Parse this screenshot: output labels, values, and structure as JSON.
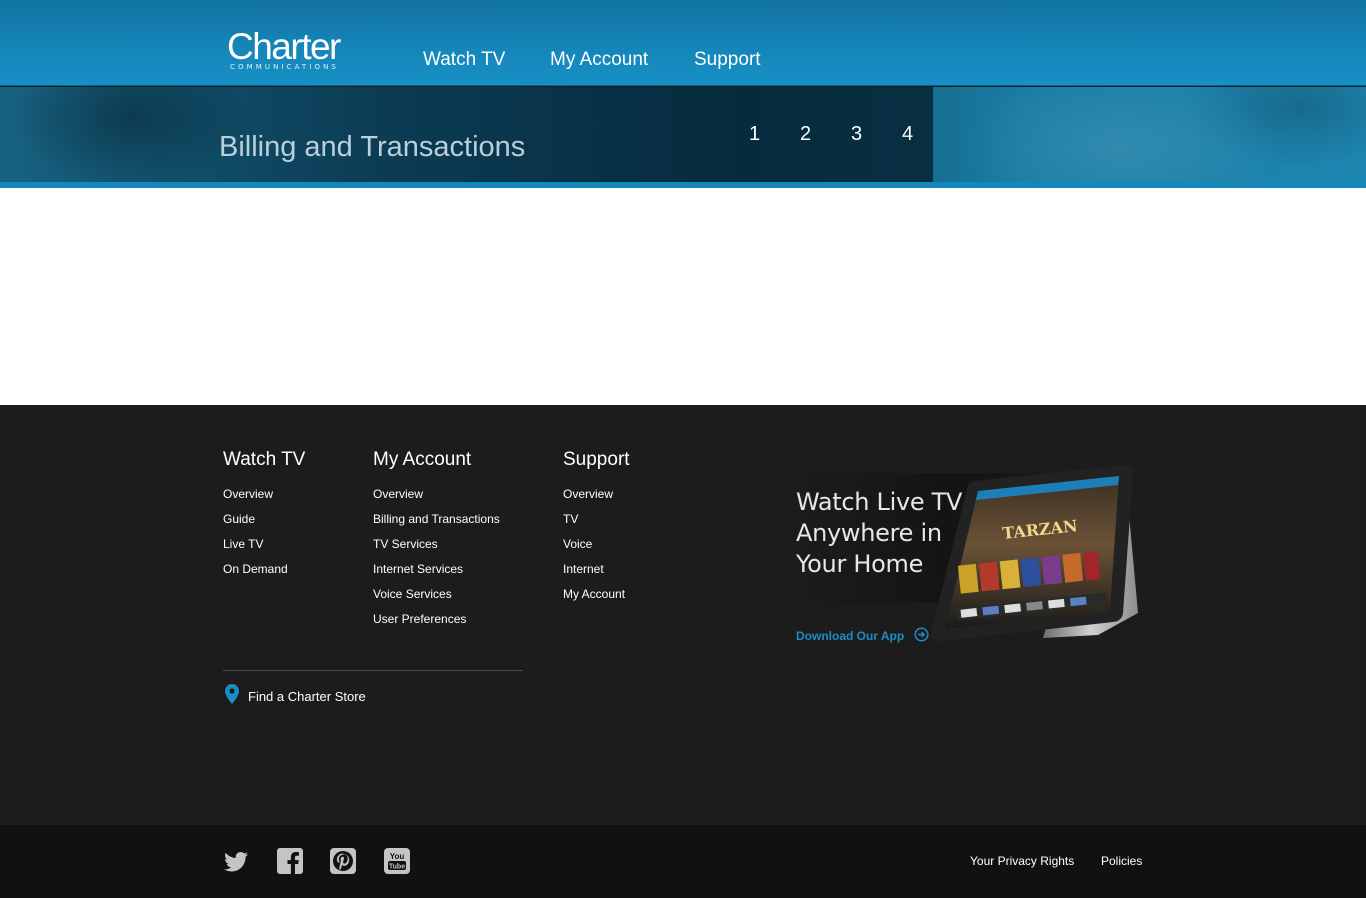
{
  "brand": {
    "name": "Charter",
    "subtitle": "COMMUNICATIONS"
  },
  "nav": {
    "items": [
      "Watch TV",
      "My Account",
      "Support"
    ]
  },
  "banner": {
    "title": "Billing and Transactions",
    "steps": [
      "1",
      "2",
      "3",
      "4"
    ]
  },
  "footer": {
    "columns": [
      {
        "heading": "Watch TV",
        "links": [
          "Overview",
          "Guide",
          "Live TV",
          "On Demand"
        ]
      },
      {
        "heading": "My Account",
        "links": [
          "Overview",
          "Billing and Transactions",
          "TV Services",
          "Internet Services",
          "Voice Services",
          "User Preferences"
        ]
      },
      {
        "heading": "Support",
        "links": [
          "Overview",
          "TV",
          "Voice",
          "Internet",
          "My Account"
        ]
      }
    ],
    "store_link": "Find a Charter Store",
    "promo": {
      "lines": [
        "Watch Live TV",
        "Anywhere in",
        "Your Home"
      ],
      "cta": "Download Our App",
      "tablet_title": "TARZAN"
    }
  },
  "bottom": {
    "social": [
      "twitter-icon",
      "facebook-icon",
      "pinterest-icon",
      "youtube-icon"
    ],
    "legal": [
      "Your Privacy Rights",
      "Policies"
    ]
  },
  "colors": {
    "brand_blue": "#1585b8",
    "footer_bg": "#1c1c1c",
    "bottom_bg": "#111111",
    "accent_link": "#1b8cc6"
  }
}
